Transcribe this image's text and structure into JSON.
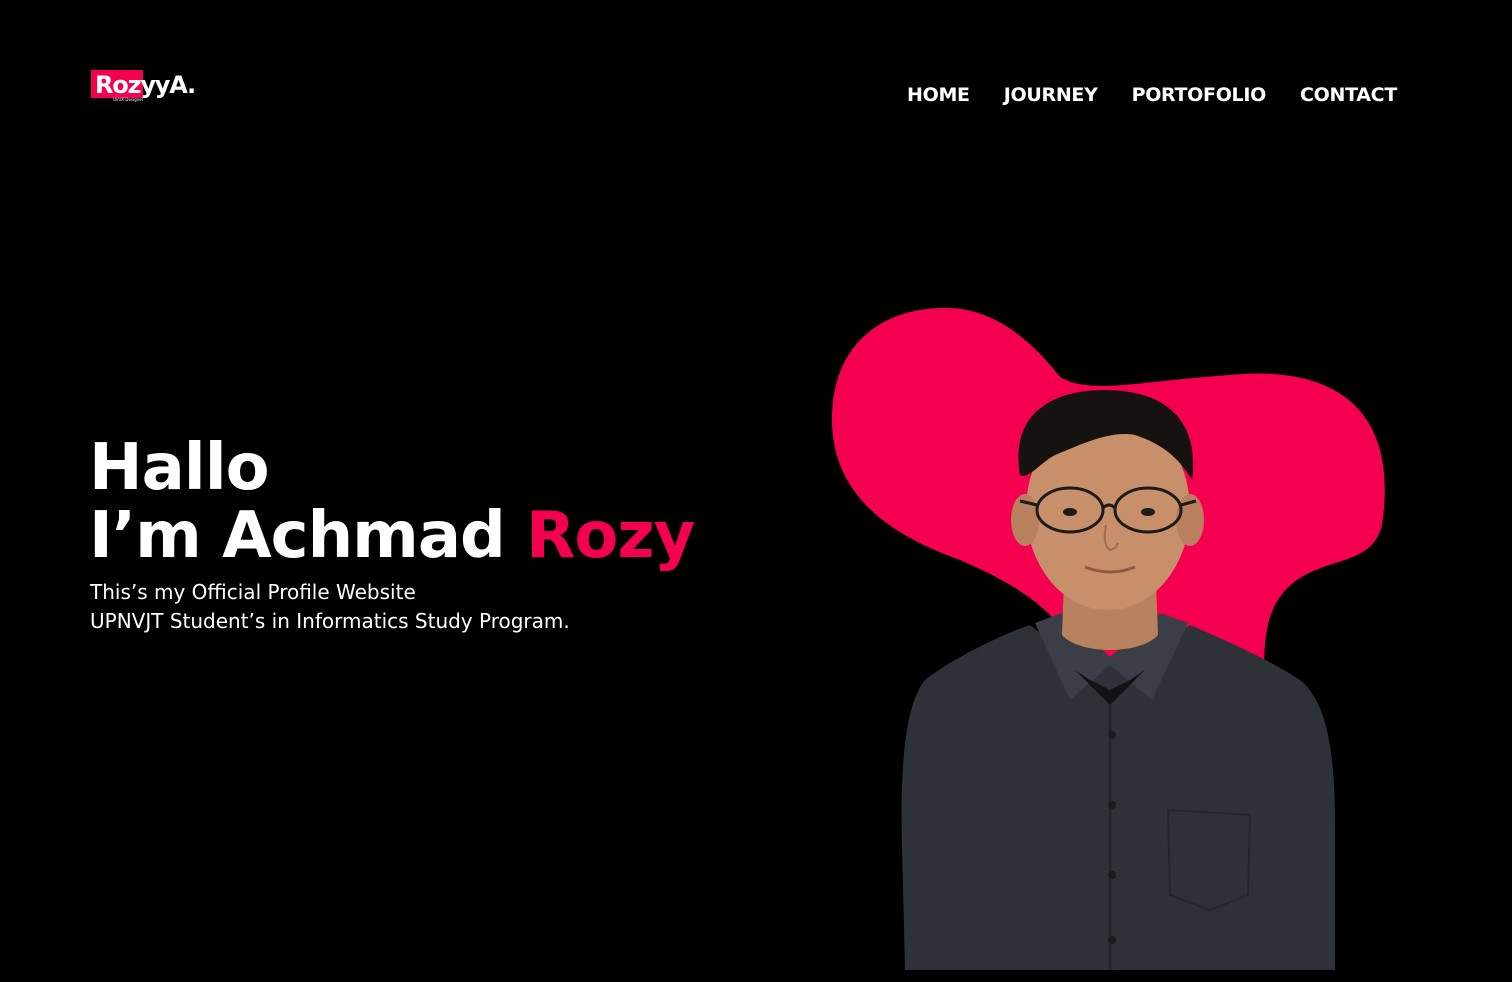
{
  "logo": {
    "text": "RozyyA.",
    "subtitle": "UI/UX Designer"
  },
  "nav": {
    "items": [
      {
        "label": "HOME"
      },
      {
        "label": "JOURNEY"
      },
      {
        "label": "PORTOFOLIO"
      },
      {
        "label": "CONTACT"
      }
    ]
  },
  "hero": {
    "line1": "Hallo",
    "line2_prefix": "I’m Achmad",
    "line2_accent": "Rozy",
    "sub_line1": "This’s my Official Profile Website",
    "sub_line2": "UPNVJT Student’s in Informatics Study Program."
  },
  "colors": {
    "background": "#000000",
    "accent": "#f50050",
    "text": "#ffffff"
  }
}
